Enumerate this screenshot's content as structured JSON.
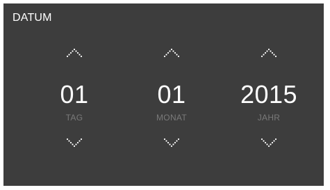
{
  "header": {
    "title": "DATUM"
  },
  "colors": {
    "background": "#3d3d3d",
    "text": "#ffffff",
    "label": "#7a7a7a"
  },
  "columns": [
    {
      "value": "01",
      "label": "TAG",
      "up_icon": "chevron-up-dotted-icon",
      "down_icon": "chevron-down-dotted-icon"
    },
    {
      "value": "01",
      "label": "MONAT",
      "up_icon": "chevron-up-dotted-icon",
      "down_icon": "chevron-down-dotted-icon"
    },
    {
      "value": "2015",
      "label": "JAHR",
      "up_icon": "chevron-up-dotted-icon",
      "down_icon": "chevron-down-dotted-icon"
    }
  ]
}
